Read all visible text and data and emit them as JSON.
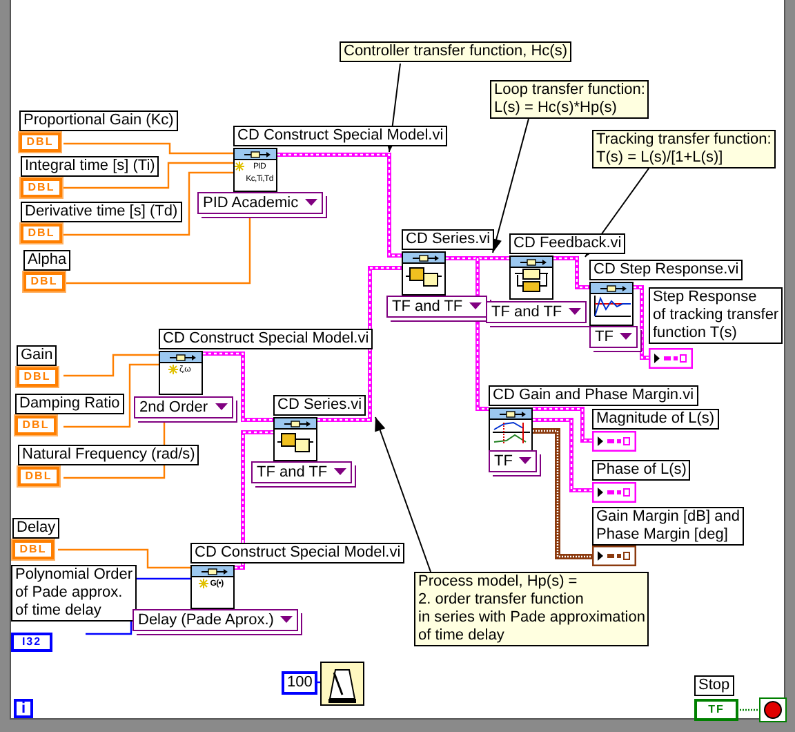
{
  "controls": [
    {
      "label": "Proportional Gain (Kc)",
      "type": "DBL"
    },
    {
      "label": "Integral time [s] (Ti)",
      "type": "DBL"
    },
    {
      "label": "Derivative time [s] (Td)",
      "type": "DBL"
    },
    {
      "label": "Alpha",
      "type": "DBL"
    },
    {
      "label": "Gain",
      "type": "DBL"
    },
    {
      "label": "Damping Ratio",
      "type": "DBL"
    },
    {
      "label": "Natural Frequency (rad/s)",
      "type": "DBL"
    },
    {
      "label": "Delay",
      "type": "DBL"
    },
    {
      "label": "Polynomial Order\nof Pade approx.\nof time delay",
      "type": "I32"
    }
  ],
  "subvis": [
    {
      "label": "CD Construct Special Model.vi",
      "kind": "pid",
      "icon_text": [
        "PID",
        "Kc,Ti,Td"
      ],
      "mode": "PID Academic"
    },
    {
      "label": "CD Construct Special Model.vi",
      "kind": "second-order",
      "icon_text": [
        "ζ,ω"
      ],
      "mode": "2nd Order"
    },
    {
      "label": "CD Series.vi",
      "kind": "series",
      "mode": "TF and TF"
    },
    {
      "label": "CD Construct Special Model.vi",
      "kind": "delay",
      "icon_text": [
        "G(•)"
      ],
      "mode": "Delay (Pade Aprox.)"
    },
    {
      "label": "CD Series.vi",
      "kind": "series",
      "mode": "TF and TF"
    },
    {
      "label": "CD Feedback.vi",
      "kind": "feedback",
      "mode": "TF and TF"
    },
    {
      "label": "CD Step Response.vi",
      "kind": "step",
      "mode": "TF"
    },
    {
      "label": "CD Gain and Phase Margin.vi",
      "kind": "bode",
      "mode": "TF"
    }
  ],
  "indicators": [
    {
      "label": "Step Response\nof tracking transfer\nfunction T(s)",
      "kind": "graph"
    },
    {
      "label": "Magnitude of L(s)",
      "kind": "graph"
    },
    {
      "label": "Phase of L(s)",
      "kind": "graph"
    },
    {
      "label": "Gain Margin [dB] and\nPhase Margin [deg]",
      "kind": "cluster"
    }
  ],
  "comments": [
    {
      "text": "Controller transfer function, Hc(s)"
    },
    {
      "text": "Loop transfer function:\nL(s) = Hc(s)*Hp(s)"
    },
    {
      "text": "Tracking transfer function:\nT(s) = L(s)/[1+L(s)]"
    },
    {
      "text": "Process model, Hp(s) =\n2. order transfer function\nin series with Pade approximation\nof time delay"
    }
  ],
  "wait": {
    "value": "100"
  },
  "loop": {
    "index": "i"
  },
  "stop": {
    "label": "Stop",
    "type": "TF"
  }
}
